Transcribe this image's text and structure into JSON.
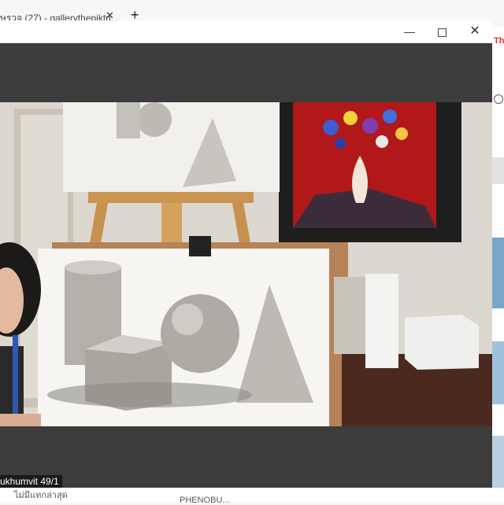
{
  "browser": {
    "tab_title": "ษรวจ (27) - gallerythepiktu...",
    "tab_close": "✕",
    "new_tab": "+",
    "side_logo": "Th",
    "bottom_text_1": "ไม่มีแทกล่าสุด",
    "bottom_text_2": "PHENOBU..."
  },
  "window": {
    "minimize": "—",
    "maximize": "☐",
    "close": "✕"
  },
  "video": {
    "participant_label": "ukhumvit 49/1"
  },
  "colors": {
    "window_bg": "#3c3c3c",
    "titlebar_bg": "#ffffff",
    "caption_bg": "#1a1a1a"
  },
  "icons": [
    "close-icon",
    "plus-icon",
    "minimize-icon",
    "maximize-icon"
  ]
}
